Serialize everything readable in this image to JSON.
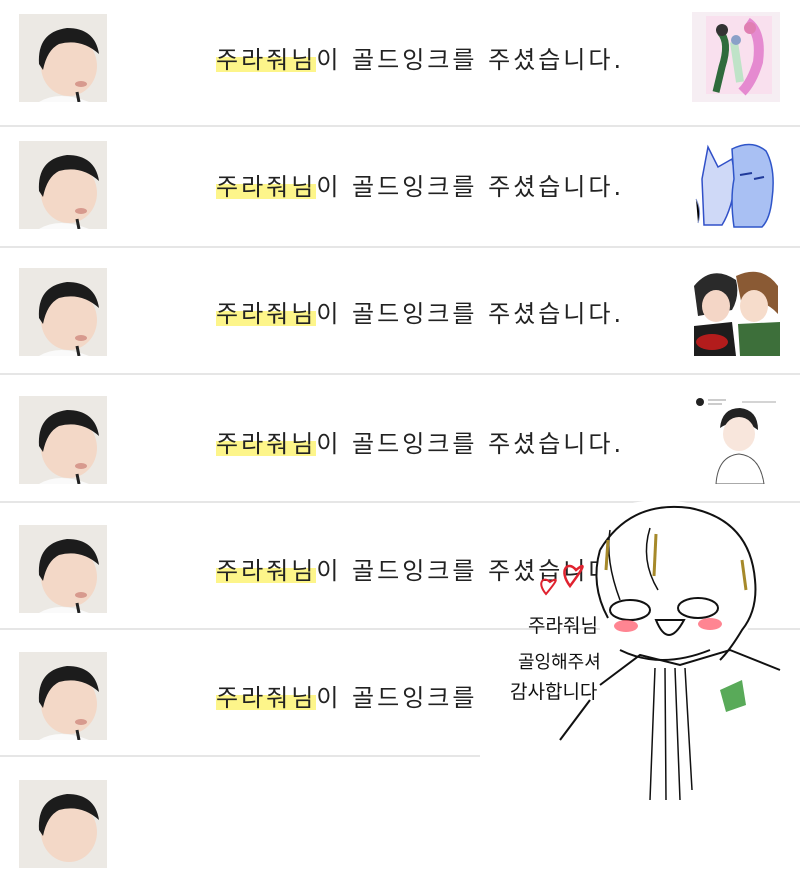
{
  "notification": {
    "user_name": "주라줘님",
    "message_suffix": "이 골드잉크를 주셨습니다."
  },
  "rows": [
    {
      "thumb_icon": "fan-art-group-icon"
    },
    {
      "thumb_icon": "fan-art-blue-cat-icon"
    },
    {
      "thumb_icon": "fan-art-couple-icon"
    },
    {
      "thumb_icon": "fan-art-boy-icon"
    },
    {
      "thumb_icon": "none"
    },
    {
      "thumb_icon": "none"
    },
    {
      "thumb_icon": "none"
    }
  ],
  "drawing": {
    "line1": "주라줘님",
    "line2": "골잉해주셔",
    "line3": "감사합니다"
  },
  "colors": {
    "highlight": "#fdf58a",
    "divider": "#e6e6e6"
  }
}
